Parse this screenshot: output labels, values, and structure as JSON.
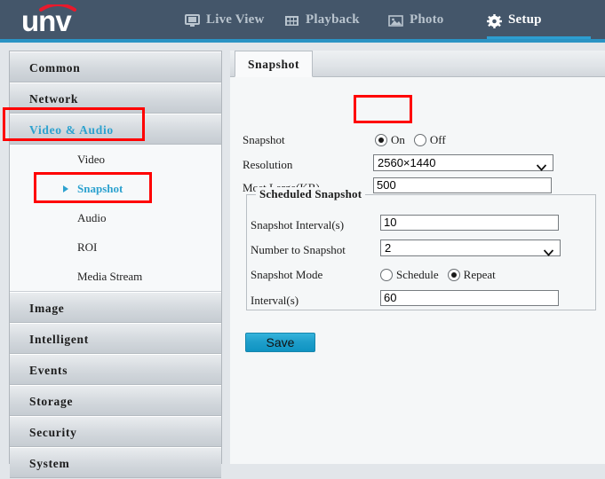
{
  "app": {
    "logo_text": "unv",
    "header_bg": "#44566a",
    "accent": "#2d9ed1",
    "highlight_text": "#2da2cf",
    "annotation_color": "#ff0000"
  },
  "topnav": {
    "items": [
      {
        "label": "Live View",
        "icon": "monitor-icon",
        "active": false
      },
      {
        "label": "Playback",
        "icon": "film-strip-icon",
        "active": false
      },
      {
        "label": "Photo",
        "icon": "picture-icon",
        "active": false
      },
      {
        "label": "Setup",
        "icon": "gear-icon",
        "active": true
      }
    ]
  },
  "sidebar": {
    "groups": [
      {
        "label": "Common",
        "selected": false
      },
      {
        "label": "Network",
        "selected": false
      },
      {
        "label": "Video & Audio",
        "selected": true,
        "annotated": true
      },
      {
        "label": "Image",
        "selected": false
      },
      {
        "label": "Intelligent",
        "selected": false
      },
      {
        "label": "Events",
        "selected": false
      },
      {
        "label": "Storage",
        "selected": false
      },
      {
        "label": "Security",
        "selected": false
      },
      {
        "label": "System",
        "selected": false
      }
    ],
    "subitems": [
      {
        "label": "Video",
        "selected": false
      },
      {
        "label": "Snapshot",
        "selected": true,
        "annotated": true
      },
      {
        "label": "Audio",
        "selected": false
      },
      {
        "label": "ROI",
        "selected": false
      },
      {
        "label": "Media Stream",
        "selected": false
      }
    ]
  },
  "main": {
    "tabs": [
      {
        "label": "Snapshot",
        "active": true
      }
    ],
    "form": {
      "snapshot_label": "Snapshot",
      "snapshot_on_label": "On",
      "snapshot_off_label": "Off",
      "snapshot_value": "On",
      "resolution_label": "Resolution",
      "resolution_value": "2560×1440",
      "most_large_label": "Most Large(KB)",
      "most_large_value": "500"
    },
    "scheduled": {
      "legend": "Scheduled Snapshot",
      "interval_label": "Snapshot Interval(s)",
      "interval_value": "10",
      "number_label": "Number to Snapshot",
      "number_value": "2",
      "mode_label": "Snapshot Mode",
      "mode_schedule_label": "Schedule",
      "mode_repeat_label": "Repeat",
      "mode_value": "Repeat",
      "repeat_interval_label": "Interval(s)",
      "repeat_interval_value": "60"
    },
    "save_label": "Save"
  }
}
